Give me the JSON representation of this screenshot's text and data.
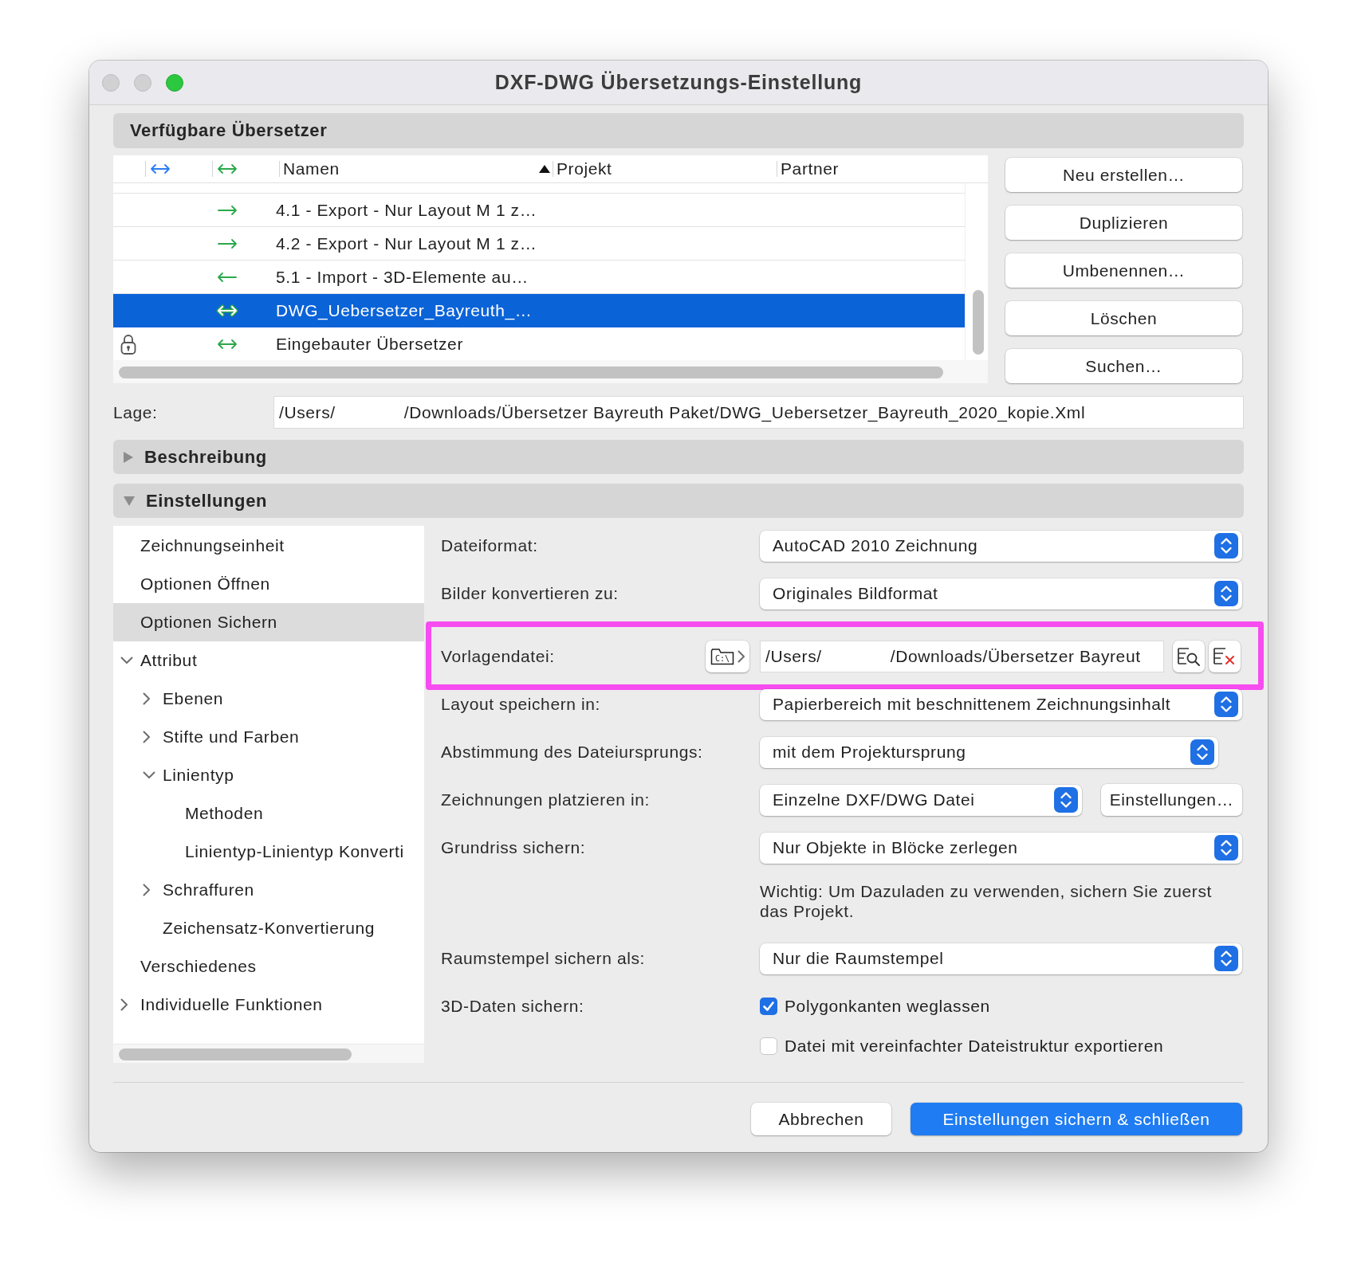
{
  "window": {
    "title": "DXF-DWG Übersetzungs-Einstellung"
  },
  "translators": {
    "title": "Verfügbare Übersetzer",
    "columns": [
      {
        "label": "Namen",
        "sorted": true
      },
      {
        "label": "Projekt",
        "sorted": false
      },
      {
        "label": "Partner",
        "sorted": false
      }
    ],
    "rows": [
      {
        "kind": "export",
        "name": "4.1 - Export - Nur Layout M 1 z…",
        "locked": false,
        "selected": false
      },
      {
        "kind": "export",
        "name": "4.2 - Export - Nur Layout M 1 z…",
        "locked": false,
        "selected": false
      },
      {
        "kind": "import",
        "name": "5.1 - Import - 3D-Elemente au…",
        "locked": false,
        "selected": false
      },
      {
        "kind": "both",
        "name": "DWG_Uebersetzer_Bayreuth_…",
        "locked": false,
        "selected": true
      },
      {
        "kind": "both",
        "name": "Eingebauter Übersetzer",
        "locked": true,
        "selected": false
      }
    ],
    "buttons": [
      "Neu erstellen…",
      "Duplizieren",
      "Umbenennen…",
      "Löschen",
      "Suchen…"
    ]
  },
  "location": {
    "label": "Lage:",
    "path_start": "/Users/",
    "path_end": "/Downloads/Übersetzer Bayreuth Paket/DWG_Uebersetzer_Bayreuth_2020_kopie.Xml"
  },
  "sections": [
    {
      "title": "Beschreibung",
      "expanded": false
    },
    {
      "title": "Einstellungen",
      "expanded": true,
      "tree": [
        {
          "label": "Zeichnungseinheit",
          "selected": false
        },
        {
          "label": "Optionen Öffnen",
          "selected": false
        },
        {
          "label": "Optionen Sichern",
          "selected": true
        },
        {
          "label": "Attribut",
          "selected": false,
          "expanded": true,
          "children": [
            {
              "label": "Ebenen",
              "selected": false,
              "expanded": false
            },
            {
              "label": "Stifte und Farben",
              "selected": false,
              "expanded": false
            },
            {
              "label": "Linientyp",
              "selected": false,
              "expanded": true,
              "children": [
                {
                  "label": "Methoden",
                  "selected": false
                },
                {
                  "label": "Linientyp-Linientyp Konverti",
                  "selected": false
                }
              ]
            },
            {
              "label": "Schraffuren",
              "selected": false,
              "expanded": false
            },
            {
              "label": "Zeichensatz-Konvertierung",
              "selected": false
            }
          ]
        },
        {
          "label": "Verschiedenes",
          "selected": false
        },
        {
          "label": "Individuelle Funktionen",
          "selected": false,
          "expanded": false
        }
      ],
      "form": [
        {
          "kind": "popup",
          "label": "Dateiformat:",
          "value": "AutoCAD 2010 Zeichnung"
        },
        {
          "kind": "popup",
          "label": "Bilder konvertieren zu:",
          "value": "Originales Bildformat"
        },
        {
          "kind": "file",
          "label": "Vorlagendatei:",
          "icon_text": "C:\\",
          "path_start": "/Users/",
          "path_end": "/Downloads/Übersetzer Bayreut",
          "highlighted": true
        },
        {
          "kind": "popup",
          "label": "Layout speichern in:",
          "value": "Papierbereich mit beschnittenem Zeichnungsinhalt"
        },
        {
          "kind": "compact",
          "label": "Abstimmung des Dateiursprungs:",
          "value": "mit dem Projektursprung"
        },
        {
          "kind": "popup",
          "label": "Zeichnungen platzieren in:",
          "value": "Einzelne DXF/DWG Datei",
          "button": "Einstellungen…"
        },
        {
          "kind": "popup",
          "label": "Grundriss sichern:",
          "value": "Nur Objekte in Blöcke zerlegen"
        },
        {
          "kind": "note",
          "text": "Wichtig: Um Dazuladen zu verwenden, sichern Sie zuerst das Projekt."
        },
        {
          "kind": "popup",
          "label": "Raumstempel sichern als:",
          "value": "Nur die Raumstempel"
        },
        {
          "kind": "checkbox",
          "label": "3D-Daten sichern:",
          "text": "Polygonkanten weglassen",
          "checked": true
        },
        {
          "kind": "checkbox",
          "text": "Datei mit vereinfachter Dateistruktur exportieren",
          "checked": false
        }
      ]
    }
  ],
  "footer": {
    "buttons": [
      {
        "label": "Abbrechen",
        "primary": false
      },
      {
        "label": "Einstellungen sichern & schließen",
        "primary": true
      }
    ]
  }
}
